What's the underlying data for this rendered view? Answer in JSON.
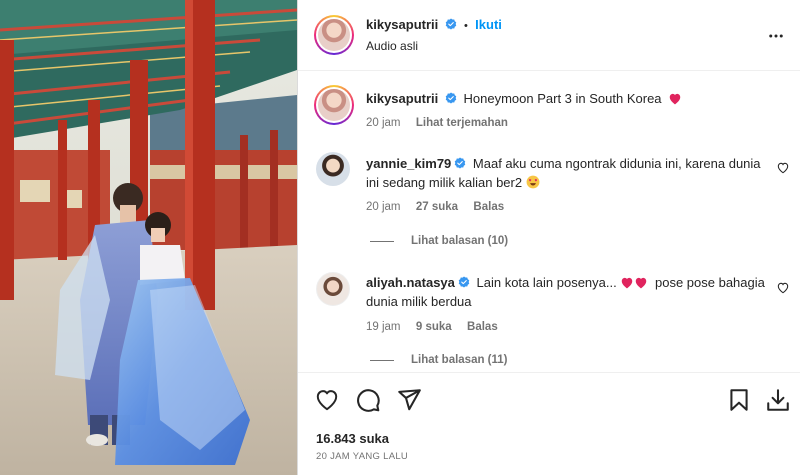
{
  "post": {
    "author": "kikysaputrii",
    "separator": "•",
    "follow_label": "Ikuti",
    "audio": "Audio asli",
    "more_icon": "more-horizontal-icon"
  },
  "caption": {
    "username": "kikysaputrii",
    "text": "Honeymoon Part 3 in South Korea",
    "emoji": "red-heart",
    "time": "20 jam",
    "translate_label": "Lihat terjemahan"
  },
  "comments": [
    {
      "username": "yannie_kim79",
      "text": "Maaf aku cuma ngontrak didunia ini, karena dunia ini sedang milik kalian ber2",
      "emoji": "heart-eyes-face",
      "time": "20 jam",
      "likes": "27 suka",
      "reply_label": "Balas",
      "view_replies": "Lihat balasan (10)"
    },
    {
      "username": "aliyah.natasya",
      "text_before": "Lain kota lain posenya...",
      "text_after": "pose pose bahagia dunia milik berdua",
      "emoji": "two-red-hearts",
      "time": "19 jam",
      "likes": "9 suka",
      "reply_label": "Balas",
      "view_replies": "Lihat balasan (11)"
    }
  ],
  "footer": {
    "likes": "16.843 suka",
    "date": "20 JAM YANG LALU"
  },
  "colors": {
    "accent_blue": "#0095f6",
    "verified_blue": "#3897f0",
    "heart_red": "#e0245e",
    "muted": "#737373"
  }
}
